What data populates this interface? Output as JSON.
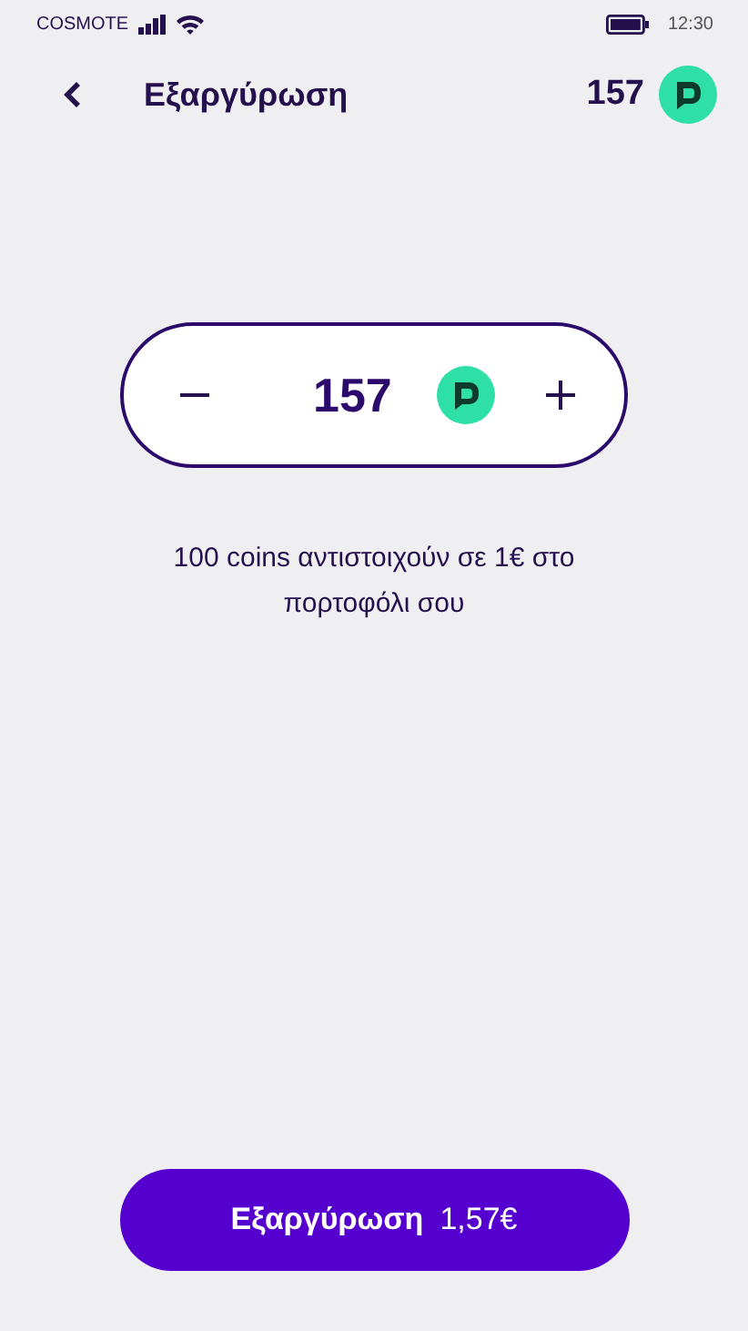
{
  "status_bar": {
    "carrier": "COSMOTE",
    "time": "12:30"
  },
  "header": {
    "title": "Εξαργύρωση",
    "balance": "157"
  },
  "stepper": {
    "value": "157"
  },
  "note": "100 coins αντιστοιχούν σε 1€ στο πορτοφόλι σου",
  "redeem_button": {
    "label": "Εξαργύρωση",
    "amount": "1,57€"
  }
}
